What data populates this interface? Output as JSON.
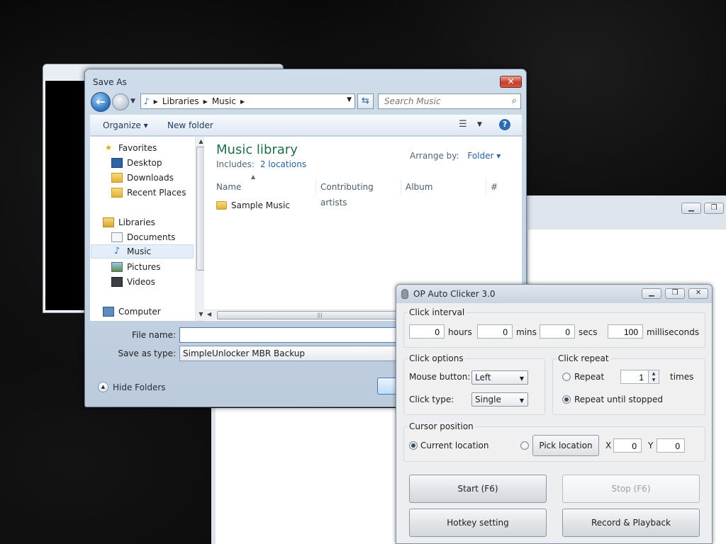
{
  "save_as": {
    "title": "Save As",
    "close_label": "✕",
    "address": {
      "crumbs": [
        "Libraries",
        "Music"
      ]
    },
    "search_placeholder": "Search Music",
    "toolbar": {
      "organize": "Organize ▾",
      "new_folder": "New folder",
      "help": "?"
    },
    "nav": {
      "favorites": "Favorites",
      "desktop": "Desktop",
      "downloads": "Downloads",
      "recent_places": "Recent Places",
      "libraries": "Libraries",
      "documents": "Documents",
      "music": "Music",
      "pictures": "Pictures",
      "videos": "Videos",
      "computer": "Computer"
    },
    "library_title": "Music library",
    "includes_label": "Includes:",
    "includes_link": "2 locations",
    "arrange_by_label": "Arrange by:",
    "arrange_by_value": "Folder ▾",
    "columns": [
      "Name",
      "Contributing artists",
      "Album",
      "#"
    ],
    "files": [
      "Sample Music"
    ],
    "file_name_label": "File name:",
    "file_name_value": "",
    "save_as_type_label": "Save as type:",
    "save_as_type_value": "SimpleUnlocker MBR Backup",
    "hide_folders": "Hide Folders"
  },
  "auto_clicker": {
    "title": "OP Auto Clicker 3.0",
    "click_interval": {
      "label": "Click interval",
      "hours_value": "0",
      "hours_label": "hours",
      "mins_value": "0",
      "mins_label": "mins",
      "secs_value": "0",
      "secs_label": "secs",
      "ms_value": "100",
      "ms_label": "milliseconds"
    },
    "click_options": {
      "label": "Click options",
      "mouse_button_label": "Mouse button:",
      "mouse_button_value": "Left",
      "click_type_label": "Click type:",
      "click_type_value": "Single"
    },
    "click_repeat": {
      "label": "Click repeat",
      "repeat_label": "Repeat",
      "repeat_value": "1",
      "times_label": "times",
      "until_stopped_label": "Repeat until stopped",
      "selected": "until_stopped"
    },
    "cursor_position": {
      "label": "Cursor position",
      "current_location_label": "Current location",
      "pick_location_label": "Pick location",
      "x_label": "X",
      "x_value": "0",
      "y_label": "Y",
      "y_value": "0",
      "selected": "current"
    },
    "buttons": {
      "start": "Start (F6)",
      "stop": "Stop (F6)",
      "hotkey": "Hotkey setting",
      "record": "Record & Playback"
    }
  },
  "colors": {
    "accent": "#2a5fa0",
    "library_title": "#1e7145",
    "close": "#c3402c"
  }
}
